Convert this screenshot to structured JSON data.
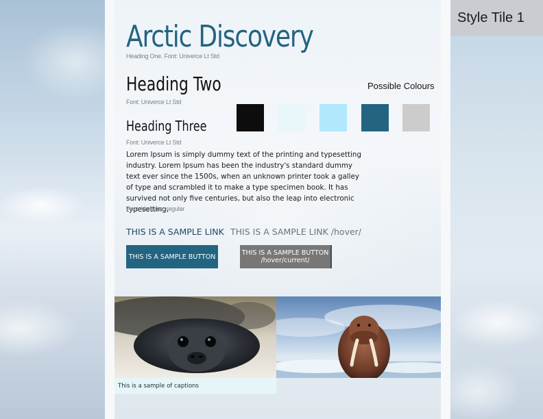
{
  "tile_label": "Style Tile 1",
  "heading_one": {
    "text": "Arctic Discovery",
    "note": "Heading One. Font: Univerce Lt Std"
  },
  "heading_two": {
    "text": "Heading Two",
    "note": "Font: Univerce Lt Std"
  },
  "heading_three": {
    "text": "Heading Three",
    "note": "Font: Univerce Lt Std"
  },
  "body": {
    "text": "Lorem Ipsum is simply dummy text of the printing and typesetting industry. Lorem Ipsum has been the industry's standard dummy text ever since the 1500s, when an unknown printer took a galley of type and scrambled it to make a type specimen book. It has survived not only five centuries, but also the leap into electronic typesetting,",
    "note": "Font: Verdana, regular"
  },
  "colours": {
    "title": "Possible Colours",
    "swatches": [
      "#0d0d0d",
      "#e9f6fa",
      "#b1e8fc",
      "#236480",
      "#cccccc"
    ]
  },
  "links": {
    "normal": "THIS IS A SAMPLE LINK",
    "hover": "THIS IS A SAMPLE LINK /hover/",
    "normal_color": "#1f4a64",
    "hover_color": "#6e7378"
  },
  "buttons": {
    "normal": "THIS IS A SAMPLE BUTTON",
    "hover_line1": "THIS IS A SAMPLE BUTTON",
    "hover_line2": "/hover/current/",
    "normal_bg": "#236480",
    "hover_bg": "#777777"
  },
  "images": {
    "left": "seal-photo",
    "right": "walrus-photo",
    "caption": "This is a sample of captions"
  }
}
